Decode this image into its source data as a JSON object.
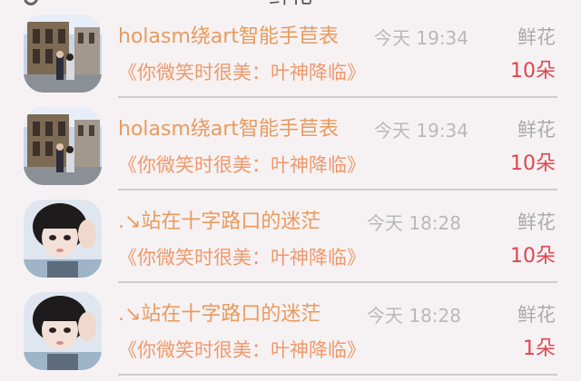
{
  "header": {
    "title": "鲜花"
  },
  "items": [
    {
      "avatar": "street-couple-photo",
      "name": "holasm绕art智能手苣表",
      "time": "今天 19:34",
      "gift_type": "鲜花",
      "song": "《你微笑时很美：叶神降临》",
      "count": "10朵"
    },
    {
      "avatar": "street-couple-photo",
      "name": "holasm绕art智能手苣表",
      "time": "今天 19:34",
      "gift_type": "鲜花",
      "song": "《你微笑时很美：叶神降临》",
      "count": "10朵"
    },
    {
      "avatar": "girl-selfie-photo",
      "name": ".↘站在十字路口的迷茫",
      "time": "今天 18:28",
      "gift_type": "鲜花",
      "song": "《你微笑时很美：叶神降临》",
      "count": "10朵"
    },
    {
      "avatar": "girl-selfie-photo",
      "name": ".↘站在十字路口的迷茫",
      "time": "今天 18:28",
      "gift_type": "鲜花",
      "song": "《你微笑时很美：叶神降临》",
      "count": "1朵"
    }
  ],
  "colors": {
    "name": "#e99a5c",
    "song": "#f0986a",
    "count": "#e0454f",
    "muted": "#b8b8b8",
    "background": "#f6f2f4"
  }
}
